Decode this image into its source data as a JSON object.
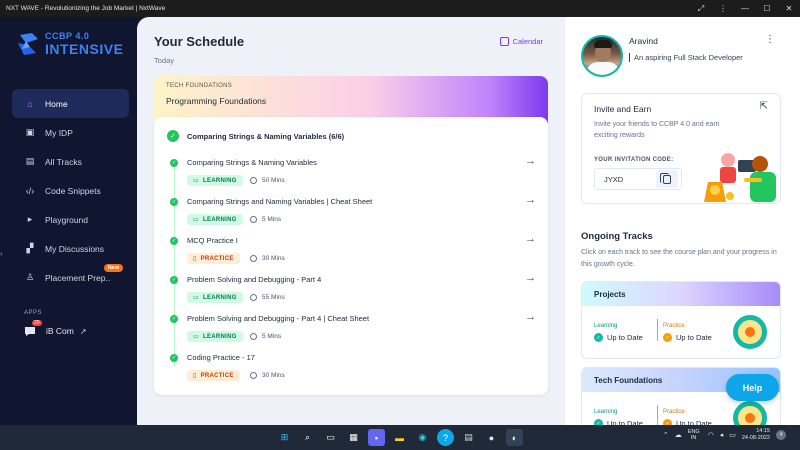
{
  "window": {
    "title": "NXT WAVE - Revolutionizing the Job Market | NxtWave",
    "controls": [
      "⤢",
      "⋮",
      "—",
      "☐",
      "✕"
    ]
  },
  "sidebar": {
    "logo_line1": "CCBP 4.0",
    "logo_line2": "INTENSIVE",
    "items": [
      {
        "label": "Home",
        "icon": "home-icon",
        "active": true
      },
      {
        "label": "My IDP",
        "icon": "idp-icon"
      },
      {
        "label": "All Tracks",
        "icon": "tracks-icon"
      },
      {
        "label": "Code Snippets",
        "icon": "code-icon"
      },
      {
        "label": "Playground",
        "icon": "terminal-icon"
      },
      {
        "label": "My Discussions",
        "icon": "discussion-icon"
      },
      {
        "label": "Placement Prep..",
        "icon": "placement-icon",
        "badge": "New"
      }
    ],
    "apps_label": "APPS",
    "ib_com": {
      "label": "iB Com",
      "count": "20"
    }
  },
  "schedule": {
    "title": "Your Schedule",
    "subtitle": "Today",
    "calendar_label": "Calendar",
    "banner_category": "TECH FOUNDATIONS",
    "banner_name": "Programming Foundations",
    "group_title": "Comparing Strings & Naming Variables (6/6)",
    "items": [
      {
        "title": "Comparing Strings & Naming Variables",
        "type": "LEARNING",
        "duration": "50 Mins"
      },
      {
        "title": "Comparing Strings and Naming Variables | Cheat Sheet",
        "type": "LEARNING",
        "duration": "5 Mins"
      },
      {
        "title": "MCQ Practice I",
        "type": "PRACTICE",
        "duration": "30 Mins"
      },
      {
        "title": "Problem Solving and Debugging - Part 4",
        "type": "LEARNING",
        "duration": "55 Mins"
      },
      {
        "title": "Problem Solving and Debugging - Part 4 | Cheat Sheet",
        "type": "LEARNING",
        "duration": "5 Mins"
      },
      {
        "title": "Coding Practice - 17",
        "type": "PRACTICE",
        "duration": "30 Mins"
      }
    ]
  },
  "profile": {
    "name": "Aravind",
    "role": "An aspiring Full Stack Developer"
  },
  "invite": {
    "title": "Invite and Earn",
    "description": "Invite your friends to CCBP 4.0 and earn exciting rewards",
    "code_label": "YOUR INVITATION CODE:",
    "code": "JYXD"
  },
  "ongoing": {
    "title": "Ongoing Tracks",
    "description": "Click on each track to see the course plan and your progress in this growth cycle.",
    "tracks": [
      {
        "name": "Projects",
        "learning_label": "Learning",
        "learning_status": "Up to Date",
        "practice_label": "Practice",
        "practice_status": "Up to Date"
      },
      {
        "name": "Tech Foundations",
        "learning_label": "Learning",
        "learning_status": "Up to Date",
        "practice_label": "Practice",
        "practice_status": "Up to Date"
      }
    ]
  },
  "help_label": "Help",
  "taskbar": {
    "lang_top": "ENG",
    "lang_bottom": "IN",
    "time": "14:15",
    "date": "24-08-2022",
    "notification_count": "4"
  },
  "colors": {
    "accent": "#7c3aed",
    "success": "#22c55e",
    "sidebar": "#10162f",
    "help": "#0ea5e9"
  }
}
